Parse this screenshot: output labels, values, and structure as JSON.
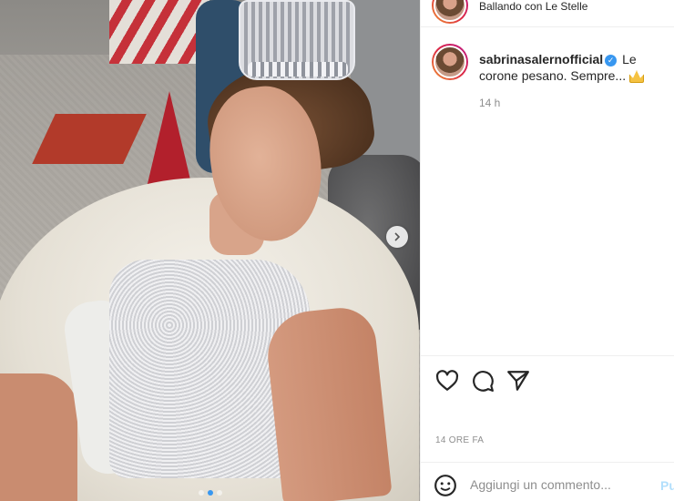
{
  "header": {
    "location": "Ballando con Le Stelle"
  },
  "post": {
    "username": "sabrinasalernofficial",
    "verified": true,
    "caption": "Le corone pesano. Sempre...",
    "caption_emoji": "crown-emoji",
    "caption_time": "14 h",
    "post_time": "14 ORE FA",
    "carousel": {
      "slides": 3,
      "current": 2
    }
  },
  "actions": {
    "like_icon": "heart-icon",
    "comment_icon": "comment-icon",
    "share_icon": "paper-plane-icon"
  },
  "comment": {
    "placeholder": "Aggiungi un commento...",
    "publish_label": "Pu"
  },
  "colors": {
    "accent": "#3897f0",
    "text": "#262626",
    "muted": "#8e8e8e",
    "border": "#efefef"
  }
}
